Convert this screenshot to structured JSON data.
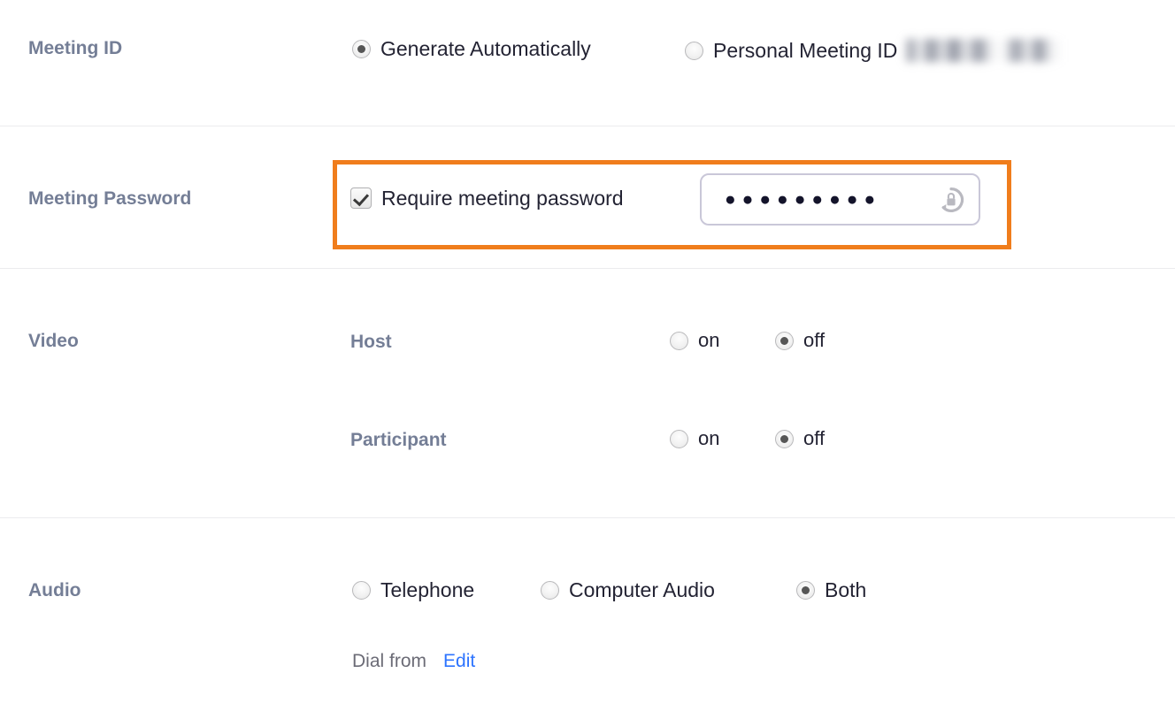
{
  "page": {
    "accent_highlight_color": "#f07d1c",
    "label_color": "#747e96",
    "link_color": "#2d74ff"
  },
  "rows": {
    "meeting_id": {
      "label": "Meeting ID",
      "options": [
        {
          "label": "Generate Automatically",
          "selected": true
        },
        {
          "label": "Personal Meeting ID",
          "selected": false
        }
      ],
      "personal_meeting_id_value": "",
      "personal_meeting_id_redacted": true
    },
    "meeting_password": {
      "label": "Meeting Password",
      "checkbox_label": "Require meeting password",
      "checkbox_checked": true,
      "password_masked_value": "●●●●●●●●●",
      "password_length": 9,
      "regenerate_icon": "lock-refresh-icon",
      "highlighted": true
    },
    "video": {
      "label": "Video",
      "groups": [
        {
          "name": "Host",
          "options": [
            {
              "label": "on",
              "selected": false
            },
            {
              "label": "off",
              "selected": true
            }
          ]
        },
        {
          "name": "Participant",
          "options": [
            {
              "label": "on",
              "selected": false
            },
            {
              "label": "off",
              "selected": true
            }
          ]
        }
      ]
    },
    "audio": {
      "label": "Audio",
      "options": [
        {
          "label": "Telephone",
          "selected": false
        },
        {
          "label": "Computer Audio",
          "selected": false
        },
        {
          "label": "Both",
          "selected": true
        }
      ],
      "dial_from_label": "Dial from",
      "edit_link_label": "Edit"
    }
  }
}
